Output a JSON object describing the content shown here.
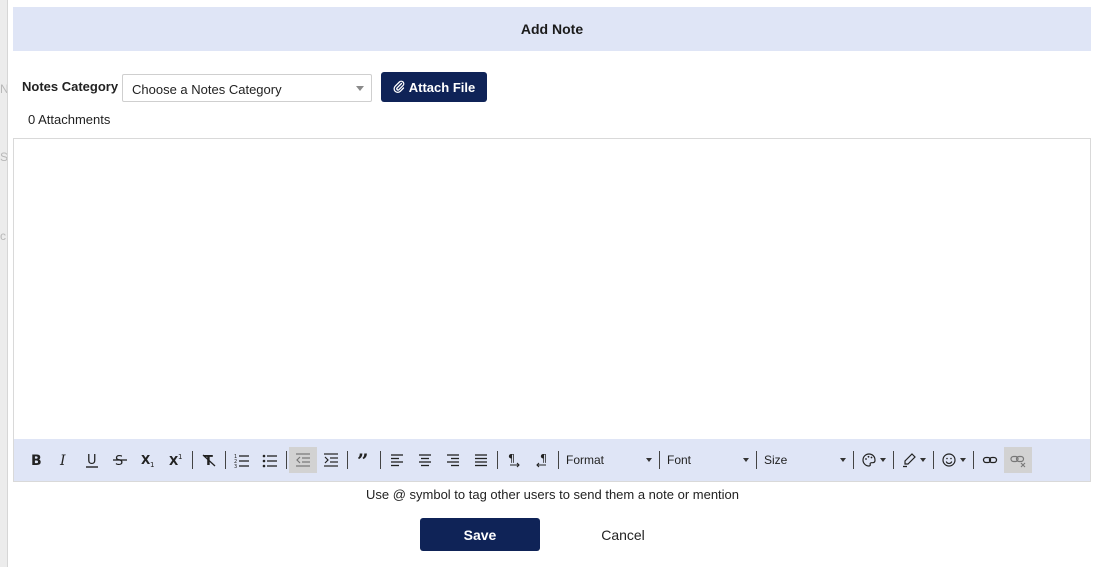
{
  "modal": {
    "title": "Add Note"
  },
  "category": {
    "label": "Notes Category",
    "selected": "Choose a Notes Category"
  },
  "attach": {
    "button_label": "Attach File",
    "count_text": "0 Attachments"
  },
  "toolbar": {
    "format_label": "Format",
    "font_label": "Font",
    "size_label": "Size",
    "buttons": [
      "bold-icon",
      "italic-icon",
      "underline-icon",
      "strikethrough-icon",
      "subscript-icon",
      "superscript-icon",
      "remove-format-icon",
      "numbered-list-icon",
      "bulleted-list-icon",
      "outdent-icon",
      "indent-icon",
      "blockquote-icon",
      "align-left-icon",
      "align-center-icon",
      "align-right-icon",
      "align-justify-icon",
      "ltr-icon",
      "rtl-icon",
      "text-color-icon",
      "highlight-icon",
      "emoji-icon",
      "link-icon",
      "unlink-icon"
    ]
  },
  "hint": "Use @ symbol to tag other users to send them a note or mention",
  "actions": {
    "save": "Save",
    "cancel": "Cancel"
  },
  "colors": {
    "header_bg": "#dfe5f6",
    "primary": "#0f2357"
  }
}
